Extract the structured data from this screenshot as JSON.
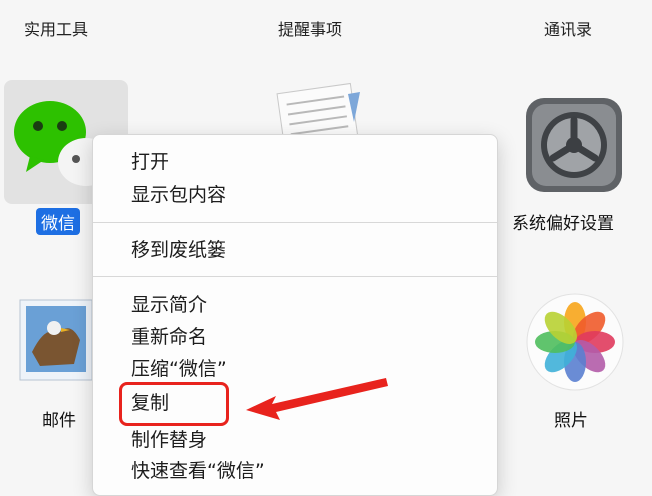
{
  "top_labels": {
    "left": "实用工具",
    "center": "提醒事项",
    "right": "通讯录"
  },
  "apps": {
    "wechat": {
      "label": "微信",
      "icon": "wechat-icon"
    },
    "notes": {
      "icon": "notes-icon"
    },
    "system_preferences": {
      "label": "系统偏好设置",
      "icon": "gear-icon"
    },
    "mail": {
      "label": "邮件",
      "icon": "mail-icon"
    },
    "photos": {
      "label": "照片",
      "icon": "photos-icon"
    }
  },
  "context_menu": {
    "items": [
      {
        "label": "打开"
      },
      {
        "label": "显示包内容"
      },
      {
        "label": "移到废纸篓"
      },
      {
        "label": "显示简介"
      },
      {
        "label": "重新命名"
      },
      {
        "label": "压缩“微信”"
      },
      {
        "label": "复制"
      },
      {
        "label": "制作替身"
      },
      {
        "label": "快速查看“微信”"
      }
    ]
  },
  "colors": {
    "selection_blue": "#1e6fe3",
    "annotation_red": "#e8231d",
    "wechat_green": "#2dc100"
  }
}
